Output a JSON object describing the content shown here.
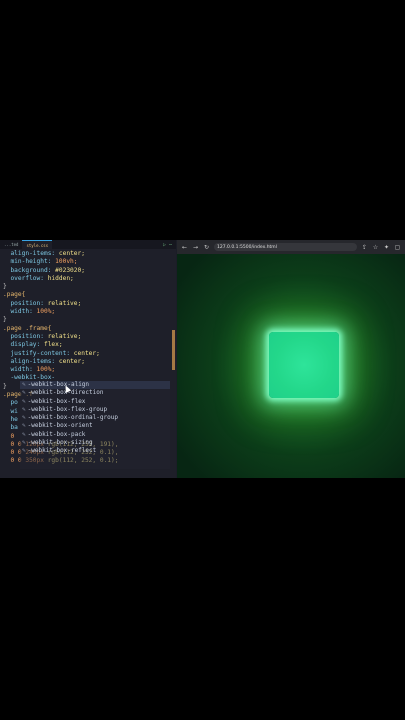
{
  "editor": {
    "tabs": [
      "...ted",
      "style.css"
    ],
    "actions": [
      "▷",
      "⋯"
    ],
    "lines": [
      [
        {
          "t": "  align-items: ",
          "c": "prop"
        },
        {
          "t": "center;",
          "c": "val"
        }
      ],
      [
        {
          "t": "  min-height: ",
          "c": "prop"
        },
        {
          "t": "100vh;",
          "c": "num"
        }
      ],
      [
        {
          "t": "  background: ",
          "c": "prop"
        },
        {
          "t": "#023020;",
          "c": "val"
        }
      ],
      [
        {
          "t": "  overflow: ",
          "c": "prop"
        },
        {
          "t": "hidden;",
          "c": "val"
        }
      ],
      [
        {
          "t": "}",
          "c": "punc"
        }
      ],
      [
        {
          "t": ".page{",
          "c": "sel"
        }
      ],
      [
        {
          "t": "  position: ",
          "c": "prop"
        },
        {
          "t": "relative;",
          "c": "val"
        }
      ],
      [
        {
          "t": "  width: ",
          "c": "prop"
        },
        {
          "t": "100%;",
          "c": "num"
        }
      ],
      [
        {
          "t": "}",
          "c": "punc"
        }
      ],
      [
        {
          "t": ".page .frame{",
          "c": "sel"
        }
      ],
      [
        {
          "t": "  position: ",
          "c": "prop"
        },
        {
          "t": "relative;",
          "c": "val"
        }
      ],
      [
        {
          "t": "  display: ",
          "c": "prop"
        },
        {
          "t": "flex;",
          "c": "val"
        }
      ],
      [
        {
          "t": "  justify-content: ",
          "c": "prop"
        },
        {
          "t": "center;",
          "c": "val"
        }
      ],
      [
        {
          "t": "  align-items: ",
          "c": "prop"
        },
        {
          "t": "center;",
          "c": "val"
        }
      ],
      [
        {
          "t": "  width: ",
          "c": "prop"
        },
        {
          "t": "100%;",
          "c": "num"
        }
      ],
      [
        {
          "t": "  -webkit-box-",
          "c": "prop"
        }
      ],
      [
        {
          "t": "}",
          "c": "punc"
        }
      ],
      [
        {
          "t": ".page .f",
          "c": "sel"
        }
      ],
      [
        {
          "t": "  po",
          "c": "prop"
        }
      ],
      [
        {
          "t": "  wi",
          "c": "prop"
        }
      ],
      [
        {
          "t": "  he",
          "c": "prop"
        }
      ],
      [
        {
          "t": "  ba",
          "c": "prop"
        }
      ],
      [
        {
          "t": "  0 ",
          "c": "num"
        }
      ],
      [
        {
          "t": "  0 0 120px ",
          "c": "num"
        },
        {
          "t": "rgb(112, 252, 191),",
          "c": "val"
        }
      ],
      [
        {
          "t": "  0 0 240px ",
          "c": "num"
        },
        {
          "t": "rgb(112, 252, 0.1),",
          "c": "val"
        }
      ],
      [
        {
          "t": "  0 0 350px ",
          "c": "num"
        },
        {
          "t": "rgb(112, 252, 0.1);",
          "c": "val"
        }
      ]
    ],
    "autocomplete": [
      "-webkit-box-align",
      "-webkit-box-direction",
      "-webkit-box-flex",
      "-webkit-box-flex-group",
      "-webkit-box-ordinal-group",
      "-webkit-box-orient",
      "-webkit-box-pack",
      "-webkit-box-sizing",
      "-webkit-box-reflect"
    ],
    "autocomplete_icon": "✎",
    "highlighted_index": 0
  },
  "browser": {
    "address": "127.0.0.1:5500/index.html",
    "nav_icons": [
      "←",
      "→",
      "↻"
    ],
    "right_icons": [
      "⇪",
      "☆",
      "✦",
      "▢"
    ]
  },
  "colors": {
    "glow": "#70fcbf",
    "box": "#23d78a",
    "page_bg": "#023020"
  }
}
